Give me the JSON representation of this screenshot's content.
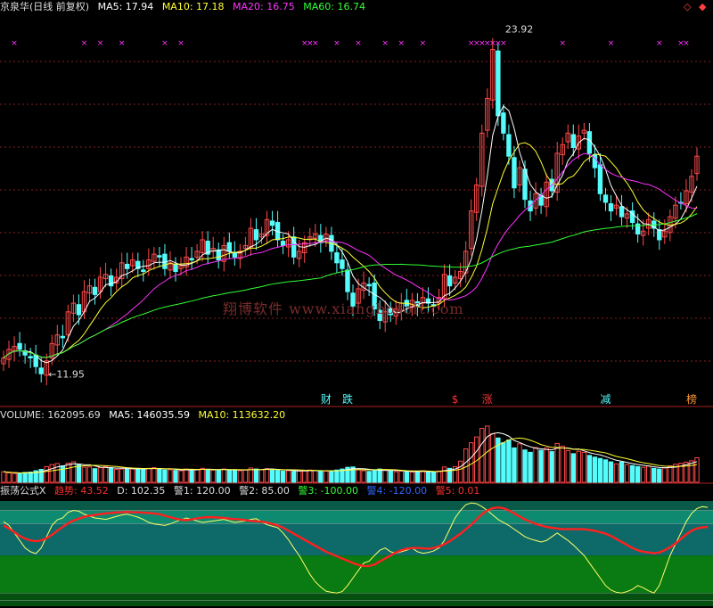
{
  "colors": {
    "bg": "#000000",
    "up": "#ff4a4a",
    "down": "#54fcfc",
    "ma5": "#ffffff",
    "ma10": "#ffff33",
    "ma20": "#ff33ff",
    "ma60": "#33ff33",
    "volume": "#cccccc",
    "grid": "#882020",
    "band_top": "#0e8a70",
    "band_mid": "#0e6a68",
    "band_low": "#0a7a12",
    "band_bottom": "#055010",
    "trend": "#ff2020",
    "d_line": "#ffff66"
  },
  "header": {
    "title": "京泉华(日线 前复权)",
    "ma5": "MA5: 17.94",
    "ma10": "MA10: 17.18",
    "ma20": "MA20: 16.75",
    "ma60": "MA60: 16.74"
  },
  "volume_header": {
    "label": "VOLUME: 162095.69",
    "ma5": "MA5: 146035.59",
    "ma10": "MA10: 113632.20"
  },
  "indicator_header": {
    "name": "振荡公式X",
    "trend": "趋势: 43.52",
    "d": "D: 102.35",
    "warn1": "警1: 120.00",
    "warn2": "警2: 85.00",
    "warn3": "警3: -100.00",
    "warn4": "警4: -120.00",
    "warn5": "警5: 0.01"
  },
  "window_controls": {
    "prev": "◇",
    "next": "◆"
  },
  "watermark": "翔博软件 www.xiangbosoft.com",
  "chart_data": {
    "type": "candlestick",
    "price_high_label": "23.92",
    "price_low_label": "11.95",
    "event_labels": [
      {
        "index": 60,
        "text": "财",
        "color": "#54fcfc"
      },
      {
        "index": 64,
        "text": "跌",
        "color": "#54fcfc"
      },
      {
        "index": 84,
        "text": "$",
        "color": "#ff3030"
      },
      {
        "index": 90,
        "text": "涨",
        "color": "#ff3030"
      },
      {
        "index": 112,
        "text": "减",
        "color": "#54fcfc"
      },
      {
        "index": 128,
        "text": "榜",
        "color": "#ff9933"
      }
    ],
    "signal_marks": [
      2,
      15,
      18,
      22,
      30,
      33,
      56,
      57,
      58,
      62,
      66,
      71,
      74,
      78,
      87,
      88,
      89,
      90,
      91,
      92,
      93,
      104,
      113,
      122,
      126,
      127
    ],
    "closes": [
      12.5,
      12.8,
      12.9,
      12.8,
      12.6,
      12.5,
      12.2,
      11.95,
      12.4,
      13.0,
      13.3,
      13.2,
      14.1,
      14.4,
      14.0,
      14.8,
      15.0,
      14.7,
      15.3,
      15.4,
      15.0,
      15.3,
      15.8,
      15.6,
      15.9,
      15.6,
      15.5,
      15.9,
      16.1,
      16.0,
      15.6,
      15.8,
      15.5,
      15.7,
      16.0,
      15.9,
      16.2,
      16.6,
      16.1,
      16.3,
      15.9,
      16.4,
      16.2,
      16.0,
      16.2,
      16.4,
      17.0,
      16.6,
      16.8,
      17.3,
      17.1,
      16.6,
      16.4,
      16.6,
      16.0,
      16.2,
      16.5,
      16.7,
      16.8,
      16.5,
      16.8,
      16.2,
      15.8,
      15.6,
      14.8,
      14.3,
      14.9,
      15.1,
      15.0,
      14.2,
      13.8,
      14.1,
      14.0,
      14.2,
      14.4,
      14.3,
      14.5,
      14.3,
      14.6,
      14.4,
      14.3,
      14.6,
      15.4,
      15.0,
      15.3,
      15.5,
      16.2,
      17.6,
      18.5,
      20.3,
      21.5,
      23.2,
      20.9,
      20.3,
      19.5,
      18.4,
      19.1,
      18.0,
      17.6,
      18.2,
      17.8,
      18.6,
      18.3,
      19.6,
      19.9,
      20.3,
      19.8,
      20.2,
      20.4,
      19.6,
      19.1,
      18.2,
      17.9,
      17.6,
      17.8,
      17.4,
      17.5,
      17.2,
      16.8,
      16.9,
      17.3,
      17.0,
      16.6,
      16.9,
      17.4,
      17.8,
      17.9,
      18.3,
      18.8,
      19.5
    ],
    "volume": [
      3.1,
      2.8,
      2.6,
      2.5,
      2.9,
      3.0,
      3.4,
      3.8,
      4.6,
      5.2,
      5.5,
      4.8,
      5.6,
      6.0,
      5.1,
      4.4,
      4.5,
      4.0,
      4.3,
      4.6,
      4.1,
      3.8,
      3.9,
      4.2,
      3.9,
      4.0,
      3.8,
      4.1,
      4.3,
      4.0,
      3.6,
      3.7,
      3.5,
      3.4,
      3.9,
      3.8,
      3.7,
      4.1,
      3.8,
      3.6,
      3.5,
      3.9,
      3.7,
      3.6,
      3.4,
      3.6,
      4.2,
      3.9,
      3.7,
      4.0,
      3.8,
      3.5,
      3.3,
      3.4,
      3.2,
      3.3,
      3.5,
      3.6,
      3.4,
      3.2,
      3.3,
      3.4,
      3.6,
      3.9,
      4.4,
      4.5,
      3.7,
      3.4,
      3.2,
      3.5,
      3.9,
      3.5,
      3.3,
      3.1,
      3.3,
      3.2,
      3.0,
      3.2,
      3.4,
      3.1,
      2.9,
      3.3,
      4.5,
      4.1,
      4.6,
      6.2,
      9.8,
      11.6,
      13.3,
      15.8,
      16.5,
      14.2,
      13.0,
      11.6,
      12.4,
      10.1,
      11.3,
      9.5,
      8.8,
      10.2,
      9.4,
      10.1,
      9.0,
      11.4,
      10.6,
      9.3,
      8.4,
      9.1,
      8.8,
      7.9,
      7.4,
      7.0,
      6.6,
      6.0,
      5.4,
      5.9,
      5.2,
      4.9,
      4.6,
      4.4,
      4.8,
      4.1,
      3.9,
      4.2,
      4.8,
      5.3,
      5.6,
      5.9,
      6.3,
      7.2
    ],
    "trend": [
      80,
      72,
      62,
      52,
      45,
      40,
      38,
      40,
      46,
      55,
      66,
      76,
      86,
      93,
      98,
      103,
      106,
      108,
      110,
      112,
      113,
      115,
      115,
      116,
      115,
      115,
      114,
      113,
      112,
      110,
      106,
      102,
      98,
      95,
      94,
      96,
      99,
      101,
      102,
      102,
      101,
      100,
      98,
      97,
      96,
      94,
      92,
      91,
      90,
      88,
      84,
      80,
      74,
      66,
      58,
      50,
      42,
      34,
      26,
      18,
      10,
      4,
      -2,
      -8,
      -14,
      -20,
      -25,
      -28,
      -28,
      -24,
      -16,
      -8,
      0,
      8,
      14,
      18,
      20,
      20,
      19,
      18,
      20,
      24,
      30,
      38,
      48,
      58,
      70,
      82,
      96,
      110,
      120,
      126,
      128,
      126,
      120,
      112,
      104,
      96,
      90,
      84,
      80,
      76,
      74,
      72,
      70,
      70,
      70,
      70,
      70,
      68,
      66,
      62,
      58,
      52,
      44,
      36,
      28,
      20,
      14,
      10,
      8,
      6,
      8,
      14,
      22,
      32,
      44,
      56,
      66,
      72,
      75,
      76
    ],
    "d_line": [
      90,
      80,
      60,
      40,
      20,
      10,
      5,
      20,
      50,
      80,
      95,
      100,
      115,
      120,
      118,
      110,
      105,
      100,
      98,
      96,
      100,
      104,
      108,
      110,
      106,
      102,
      96,
      88,
      84,
      82,
      80,
      84,
      90,
      95,
      100,
      96,
      92,
      88,
      90,
      92,
      94,
      96,
      92,
      88,
      90,
      92,
      96,
      98,
      90,
      82,
      78,
      74,
      60,
      42,
      20,
      0,
      -25,
      -50,
      -70,
      -84,
      -95,
      -98,
      -100,
      -96,
      -80,
      -60,
      -40,
      -20,
      -15,
      0,
      14,
      20,
      10,
      6,
      10,
      14,
      20,
      10,
      6,
      8,
      12,
      20,
      40,
      70,
      100,
      120,
      135,
      140,
      138,
      130,
      120,
      108,
      96,
      88,
      80,
      70,
      60,
      50,
      44,
      40,
      36,
      40,
      50,
      60,
      50,
      40,
      28,
      14,
      0,
      -20,
      -40,
      -60,
      -80,
      -92,
      -98,
      -100,
      -96,
      -90,
      -80,
      -86,
      -94,
      -100,
      -80,
      -40,
      0,
      30,
      60,
      90,
      112,
      125,
      130,
      128
    ]
  }
}
